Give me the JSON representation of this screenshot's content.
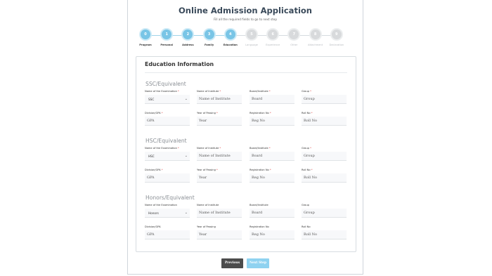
{
  "header": {
    "title": "Online Admission Application",
    "subtitle": "Fill all the required fields to go to next step"
  },
  "steps": [
    {
      "num": "0",
      "label": "Program",
      "state": "active"
    },
    {
      "num": "1",
      "label": "Personal",
      "state": "active"
    },
    {
      "num": "2",
      "label": "Address",
      "state": "active"
    },
    {
      "num": "3",
      "label": "Family",
      "state": "active"
    },
    {
      "num": "4",
      "label": "Education",
      "state": "active"
    },
    {
      "num": "5",
      "label": "Language",
      "state": "inactive"
    },
    {
      "num": "6",
      "label": "Experience",
      "state": "inactive"
    },
    {
      "num": "7",
      "label": "Other",
      "state": "inactive"
    },
    {
      "num": "8",
      "label": "Attachment",
      "state": "inactive"
    },
    {
      "num": "9",
      "label": "Declaration",
      "state": "inactive"
    }
  ],
  "form": {
    "title": "Education Information",
    "sections": [
      {
        "title": "SSC/Equivalent",
        "labels": {
          "exam": "Name of the Examination",
          "institute": "Name of Institute",
          "board": "Board/Institute",
          "group": "Group",
          "division": "Division/GPA",
          "year": "Year of Passing",
          "reg": "Registration No",
          "roll": "Roll No"
        },
        "required": true,
        "exam_value": "SSC",
        "placeholders": {
          "institute": "Name of Institute",
          "board": "Board",
          "group": "Group",
          "division": "GPA",
          "year": "Year",
          "reg": "Reg No",
          "roll": "Roll No"
        }
      },
      {
        "title": "HSC/Equivalent",
        "labels": {
          "exam": "Name of the Examination",
          "institute": "Name of Institute",
          "board": "Board/Institute",
          "group": "Group",
          "division": "Division/GPA",
          "year": "Year of Passing",
          "reg": "Registration No",
          "roll": "Roll No"
        },
        "required": true,
        "exam_value": "HSC",
        "placeholders": {
          "institute": "Name of Institute",
          "board": "Board",
          "group": "Group",
          "division": "GPA",
          "year": "Year",
          "reg": "Reg No",
          "roll": "Roll No"
        }
      },
      {
        "title": "Honors/Equivalent",
        "labels": {
          "exam": "Name of the Examination",
          "institute": "Name of Institute",
          "board": "Board/Institute",
          "group": "Group",
          "division": "Division/GPA",
          "year": "Year of Passing",
          "reg": "Registration No",
          "roll": "Roll No"
        },
        "required": false,
        "exam_value": "Honors",
        "placeholders": {
          "institute": "Name of Institute",
          "board": "Board",
          "group": "Group",
          "division": "GPA",
          "year": "Year",
          "reg": "Reg No",
          "roll": "Roll No"
        }
      }
    ]
  },
  "buttons": {
    "previous": "Previous",
    "next": "Next Step"
  },
  "colors": {
    "active_step": "#79c5e6",
    "inactive_step": "#d8dadc",
    "prev_button": "#4c4c4c",
    "next_button": "#8fd2f0"
  }
}
